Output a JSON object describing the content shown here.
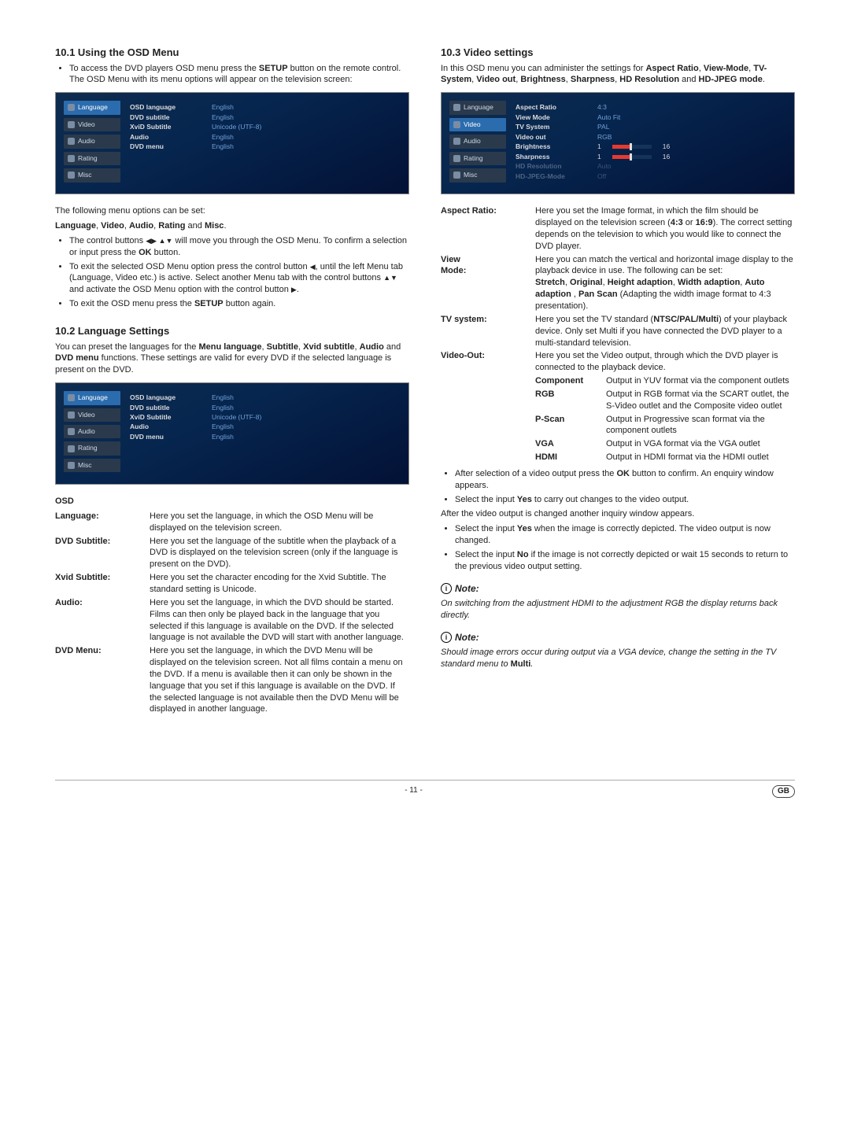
{
  "left": {
    "s101": {
      "heading": "10.1 Using the OSD Menu",
      "b1": "To access the DVD players OSD menu press the ",
      "b1b": "SETUP",
      "b1c": " button on the remote control.",
      "b2": "The OSD Menu with its menu options will appear on the television screen:"
    },
    "screenshot1": {
      "tabs": [
        "Language",
        "Video",
        "Audio",
        "Rating",
        "Misc"
      ],
      "rows": [
        [
          "OSD language",
          "English"
        ],
        [
          "DVD subtitle",
          "English"
        ],
        [
          "XviD Subtitle",
          "Unicode (UTF-8)"
        ],
        [
          "Audio",
          "English"
        ],
        [
          "DVD menu",
          "English"
        ]
      ]
    },
    "after1": {
      "p1": "The following menu options can be set:",
      "p2a": "Language",
      "p2b": "Video",
      "p2c": "Audio",
      "p2d": "Rating",
      "p2e": "Misc",
      "li1a": "The control buttons ",
      "li1b": " will move you through the OSD Menu. To confirm a selection or input press the ",
      "li1c": "OK",
      "li1d": " button.",
      "li2a": "To exit the selected OSD Menu option press the control button ",
      "li2b": ", until the left Menu tab (Language, Video etc.) is active. Select another Menu tab with the control buttons ",
      "li2c": " and activate the OSD Menu option with the control button ",
      "li2d": ".",
      "li3a": "To exit the OSD menu press the ",
      "li3b": "SETUP",
      "li3c": " button again."
    },
    "s102": {
      "heading": "10.2 Language Settings",
      "intro1": "You can preset the languages for the  ",
      "intro_b1": "Menu language",
      "intro_b2": "Subtitle",
      "intro_b3": "Xvid subtitle",
      "intro_b4": "Audio",
      "intro_b5": "DVD menu",
      "intro2": " functions. These settings are valid for every DVD if the selected language is present on the DVD."
    },
    "screenshot2": {
      "tabs": [
        "Language",
        "Video",
        "Audio",
        "Rating",
        "Misc"
      ],
      "rows": [
        [
          "OSD language",
          "English"
        ],
        [
          "DVD subtitle",
          "English"
        ],
        [
          "XviD Subtitle",
          "Unicode (UTF-8)"
        ],
        [
          "Audio",
          "English"
        ],
        [
          "DVD menu",
          "English"
        ]
      ]
    },
    "defs": {
      "osd_k": "OSD",
      "lang_k": "Language:",
      "lang_v": "Here you set the language, in which the OSD Menu will be displayed on the television screen.",
      "dvdsub_k": "DVD Subtitle:",
      "dvdsub_v": "Here you set the language of the subtitle when the playback of a DVD is displayed on the television screen (only if the language is present on the DVD).",
      "xvid_k": "Xvid Subtitle:",
      "xvid_v": "Here you set the character encoding for the Xvid Subtitle. The standard setting is Unicode.",
      "audio_k": "Audio:",
      "audio_v": "Here you set the language, in which the DVD should be started. Films can then only be played back in the language that you selected if this language is available on the DVD. If the selected language is not available the DVD will start with another language.",
      "dvdmenu_k": "DVD Menu:",
      "dvdmenu_v": "Here you set the language, in which the DVD Menu will be displayed on the television screen. Not all films contain a menu on the DVD. If a menu is available then it can only be shown in the language that you set if this language is available on the DVD. If the selected language is not available then the DVD Menu will be displayed in another language."
    }
  },
  "right": {
    "s103": {
      "heading": "10.3 Video settings",
      "intro_a": "In this OSD menu you can administer the settings for ",
      "b1": "Aspect Ratio",
      "b2": "View-Mode",
      "b3": "TV-System",
      "b4": "Video out",
      "b5": "Brightness",
      "b6": "Sharpness",
      "b7": "HD Resolution",
      "b8": "HD-JPEG mode",
      "intro_b": " and "
    },
    "screenshot3": {
      "tabs": [
        "Language",
        "Video",
        "Audio",
        "Rating",
        "Misc"
      ],
      "rows": [
        [
          "Aspect Ratio",
          "4:3"
        ],
        [
          "View Mode",
          "Auto Fit"
        ],
        [
          "TV System",
          "PAL"
        ],
        [
          "Video out",
          "RGB"
        ]
      ],
      "sliders": [
        [
          "Brightness",
          "1",
          "16"
        ],
        [
          "Sharpness",
          "1",
          "16"
        ]
      ],
      "dimrows": [
        [
          "HD Resolution",
          "Auto"
        ],
        [
          "HD-JPEG-Mode",
          "Off"
        ]
      ]
    },
    "defs": {
      "ar_k": "Aspect Ratio:",
      "ar_v_a": "Here you set the Image format, in which the film should be displayed on the television screen (",
      "ar_v_b1": "4:3",
      "ar_v_or": " or ",
      "ar_v_b2": "16:9",
      "ar_v_c": "). The correct setting depends on the television to which you would like to connect the DVD player.",
      "vm_k1": "View",
      "vm_k2": "Mode:",
      "vm_v1": "Here you can match the vertical and horizontal image display to the playback device in use. The following can be set:",
      "vm_b1": "Stretch",
      "vm_b2": "Original",
      "vm_b3": "Height adaption",
      "vm_b4": "Width adaption",
      "vm_b5": "Auto adaption",
      "vm_b6": "Pan Scan",
      "vm_v2": " (Adapting the width image format to 4:3 presentation).",
      "tv_k": "TV system:",
      "tv_v_a": "Here you set the TV standard (",
      "tv_v_b": "NTSC/PAL/Multi",
      "tv_v_c": ") of your playback device. Only set Multi if you have connected the DVD player to a  multi-standard television.",
      "vo_k": "Video-Out:",
      "vo_v": "Here you set the Video output, through which the DVD player is connected to the playback device.",
      "vo_comp_k": "Component",
      "vo_comp_v": "Output in YUV format via the component outlets",
      "vo_rgb_k": "RGB",
      "vo_rgb_v": "Output in RGB format via the SCART outlet, the S-Video outlet and the Composite video outlet",
      "vo_pscan_k": "P-Scan",
      "vo_pscan_v": "Output in Progressive scan format via the component outlets",
      "vo_vga_k": "VGA",
      "vo_vga_v": "Output in VGA format via the VGA outlet",
      "vo_hdmi_k": "HDMI",
      "vo_hdmi_v": "Output in HDMI format via the HDMI outlet"
    },
    "bullets": {
      "b1a": "After selection of a video output press the ",
      "b1b": "OK",
      "b1c": " button to confirm. An enquiry window appears.",
      "b2a": "Select the input ",
      "b2b": "Yes",
      "b2c": " to carry out changes to the video output.",
      "p3": "After the video output is changed another inquiry window appears.",
      "b3a": "Select the input ",
      "b3b": "Yes",
      "b3c": " when the image is correctly depicted. The video output is now changed.",
      "b4a": "Select the input ",
      "b4b": "No",
      "b4c": " if the image is not correctly depicted or wait 15 seconds to return to the previous video output setting."
    },
    "note1": {
      "head": "Note:",
      "body": "On switching from the adjustment HDMI to the adjustment RGB the display returns back directly."
    },
    "note2": {
      "head": "Note:",
      "body_a": "Should image errors occur during output via a VGA device, change the setting in the TV standard menu to ",
      "body_b": "Multi",
      "body_c": "."
    }
  },
  "footer": {
    "page": "- 11 -",
    "region": "GB"
  }
}
